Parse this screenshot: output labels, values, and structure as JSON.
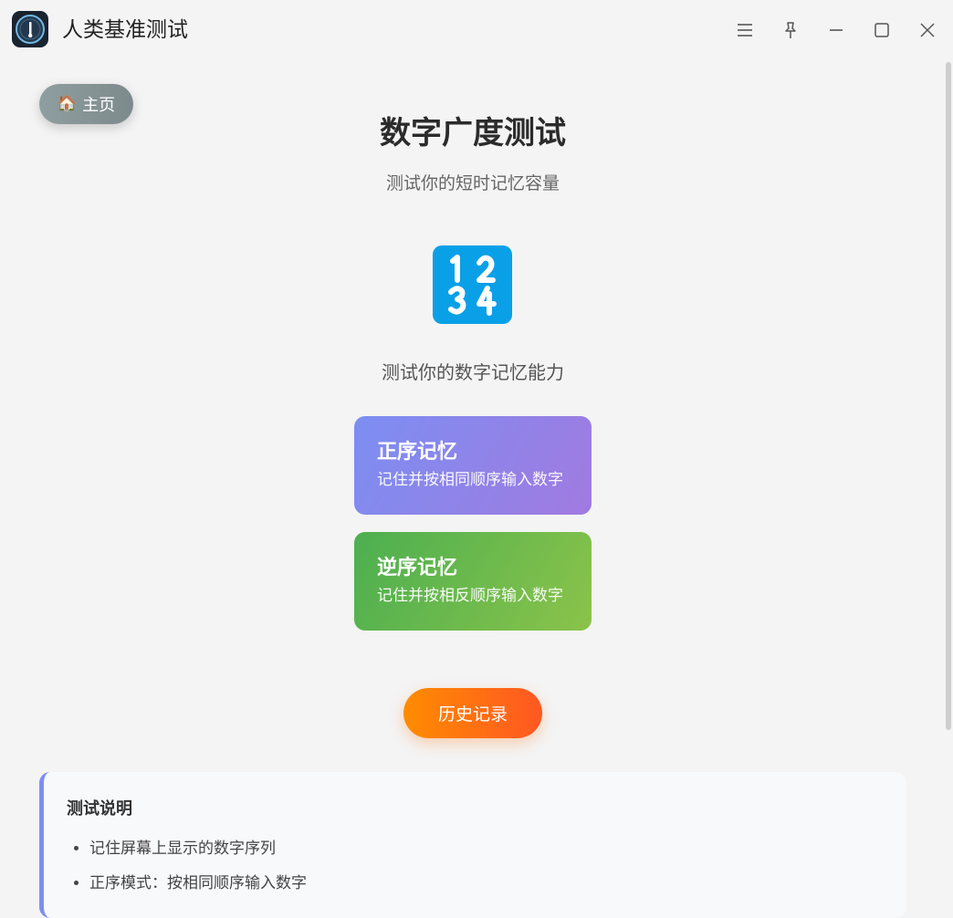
{
  "window": {
    "title": "人类基准测试",
    "controls": [
      "menu-icon",
      "pin-icon",
      "minimize-icon",
      "maximize-icon",
      "close-icon"
    ]
  },
  "nav": {
    "home_label": "主页",
    "home_icon": "house-icon"
  },
  "page": {
    "title": "数字广度测试",
    "subtitle": "测试你的短时记忆容量",
    "icon": "digits-1234-icon",
    "icon_color": "#0aa0e8",
    "description": "测试你的数字记忆能力"
  },
  "modes": [
    {
      "title": "正序记忆",
      "desc": "记住并按相同顺序输入数字",
      "gradient": [
        "#7c8ef2",
        "#a17ae0"
      ]
    },
    {
      "title": "逆序记忆",
      "desc": "记住并按相反顺序输入数字",
      "gradient": [
        "#4caf50",
        "#8bc34a"
      ]
    }
  ],
  "history": {
    "label": "历史记录",
    "gradient": [
      "#ff8c00",
      "#ff5722"
    ]
  },
  "instructions": {
    "title": "测试说明",
    "items": [
      "记住屏幕上显示的数字序列",
      "正序模式：按相同顺序输入数字"
    ]
  }
}
